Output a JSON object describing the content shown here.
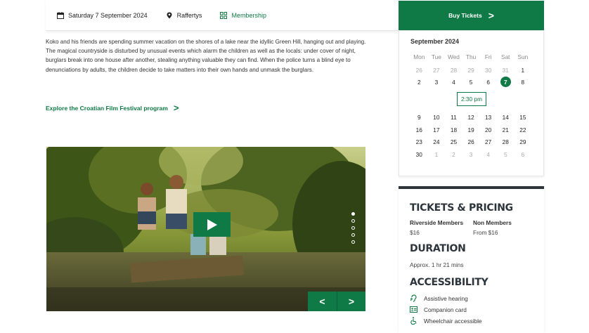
{
  "info_bar": {
    "date": "Saturday 7 September 2024",
    "venue": "Raffertys",
    "membership": "Membership"
  },
  "synopsis": "Koko and his friends are spending summer vacation on the shores of a lake near the idyllic Green Hill, hanging out and playing. The magical countryside is disturbed by unusual events which alarm the children as well as the locals: under cover of night, burglars break into one house after another, stealing anything valuable they can find. When the police turns a blind eye to denunciations by adults, the children decide to take matters into their own hands and unmask the burglars.",
  "explore_link": "Explore the Croatian Film Festival program",
  "media": {
    "slide_count": 5,
    "active_slide": 1,
    "prev_label": "<",
    "next_label": ">"
  },
  "buy_tickets": "Buy Tickets",
  "calendar": {
    "month": "September 2024",
    "weekdays": [
      "Mon",
      "Tue",
      "Wed",
      "Thu",
      "Fri",
      "Sat",
      "Sun"
    ],
    "weeks": [
      [
        "26",
        "27",
        "28",
        "29",
        "30",
        "31",
        "1"
      ],
      [
        "2",
        "3",
        "4",
        "5",
        "6",
        "7",
        "8"
      ],
      [
        "9",
        "10",
        "11",
        "12",
        "13",
        "14",
        "15"
      ],
      [
        "16",
        "17",
        "18",
        "19",
        "20",
        "21",
        "22"
      ],
      [
        "23",
        "24",
        "25",
        "26",
        "27",
        "28",
        "29"
      ],
      [
        "30",
        "1",
        "2",
        "3",
        "4",
        "5",
        "6"
      ]
    ],
    "selected": "7",
    "time_slot": "2:30 pm"
  },
  "pricing": {
    "heading": "TICKETS & PRICING",
    "members_label": "Riverside Members",
    "members_price": "$16",
    "non_members_label": "Non Members",
    "non_members_price": "From $16"
  },
  "duration": {
    "heading": "DURATION",
    "value": "Approx. 1 hr 21 mins"
  },
  "accessibility": {
    "heading": "ACCESSIBILITY",
    "items": [
      {
        "icon": "hearing-icon",
        "label": "Assistive hearing"
      },
      {
        "icon": "companion-card-icon",
        "label": "Companion card"
      },
      {
        "icon": "wheelchair-icon",
        "label": "Wheelchair accessible"
      }
    ]
  },
  "colors": {
    "brand_green": "#0f7a45",
    "dark_slate": "#2d353c"
  }
}
